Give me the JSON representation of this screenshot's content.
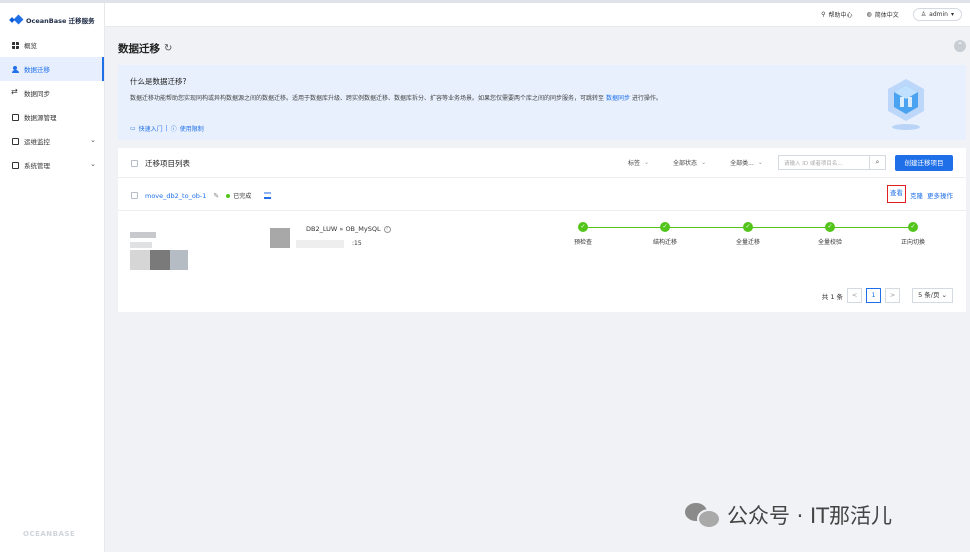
{
  "app": {
    "logo_text": "OceanBase 迁移服务",
    "footer_brand": "OCEANBASE"
  },
  "sidebar": {
    "items": [
      {
        "label": "概览",
        "icon": "grid-icon",
        "active": false
      },
      {
        "label": "数据迁移",
        "icon": "people-icon",
        "active": true
      },
      {
        "label": "数据同步",
        "icon": "sync-icon",
        "active": false
      },
      {
        "label": "数据源管理",
        "icon": "database-icon",
        "active": false
      },
      {
        "label": "运维监控",
        "icon": "monitor-icon",
        "active": false,
        "expandable": true
      },
      {
        "label": "系统管理",
        "icon": "system-icon",
        "active": false,
        "expandable": true
      }
    ]
  },
  "header": {
    "help": "帮助中心",
    "language": "简体中文",
    "user": "admin"
  },
  "page": {
    "title": "数据迁移"
  },
  "intro": {
    "title": "什么是数据迁移?",
    "desc_before": "数据迁移功能帮助您实现同构或异构数据源之间的数据迁移。适用于数据库升级、跨实例数据迁移、数据库拆分、扩容等业务场景。如果您仅需要两个库之间的同步服务，可跳转至",
    "desc_link": "数据同步",
    "desc_after": "进行操作。",
    "quick_start": "快速入门",
    "separator": "|",
    "limits": "使用限制"
  },
  "list": {
    "title": "迁移项目列表",
    "filters": [
      "标签",
      "全部状态",
      "全部类..."
    ],
    "search_placeholder": "请输入 ID 或者项目名...",
    "create_button": "创建迁移项目"
  },
  "project": {
    "name": "move_db2_to_ob-1",
    "status": "已完成",
    "route": "DB2_LUW » OB_MySQL",
    "time_fragment": ":15",
    "actions": {
      "detail": "查看",
      "clone": "克隆",
      "more": "更多操作"
    },
    "steps": [
      "预检查",
      "结构迁移",
      "全量迁移",
      "全量校验",
      "正向切换"
    ]
  },
  "pager": {
    "total": "共 1 条",
    "prev": "<",
    "current_page": "1",
    "next": ">",
    "page_size": "5 条/页"
  },
  "watermark": {
    "text": "公众号 · IT那活儿"
  },
  "colors": {
    "primary": "#1f6fe8",
    "success": "#52c41a",
    "highlight": "#e02020",
    "intro_bg": "#e8f0fd"
  }
}
